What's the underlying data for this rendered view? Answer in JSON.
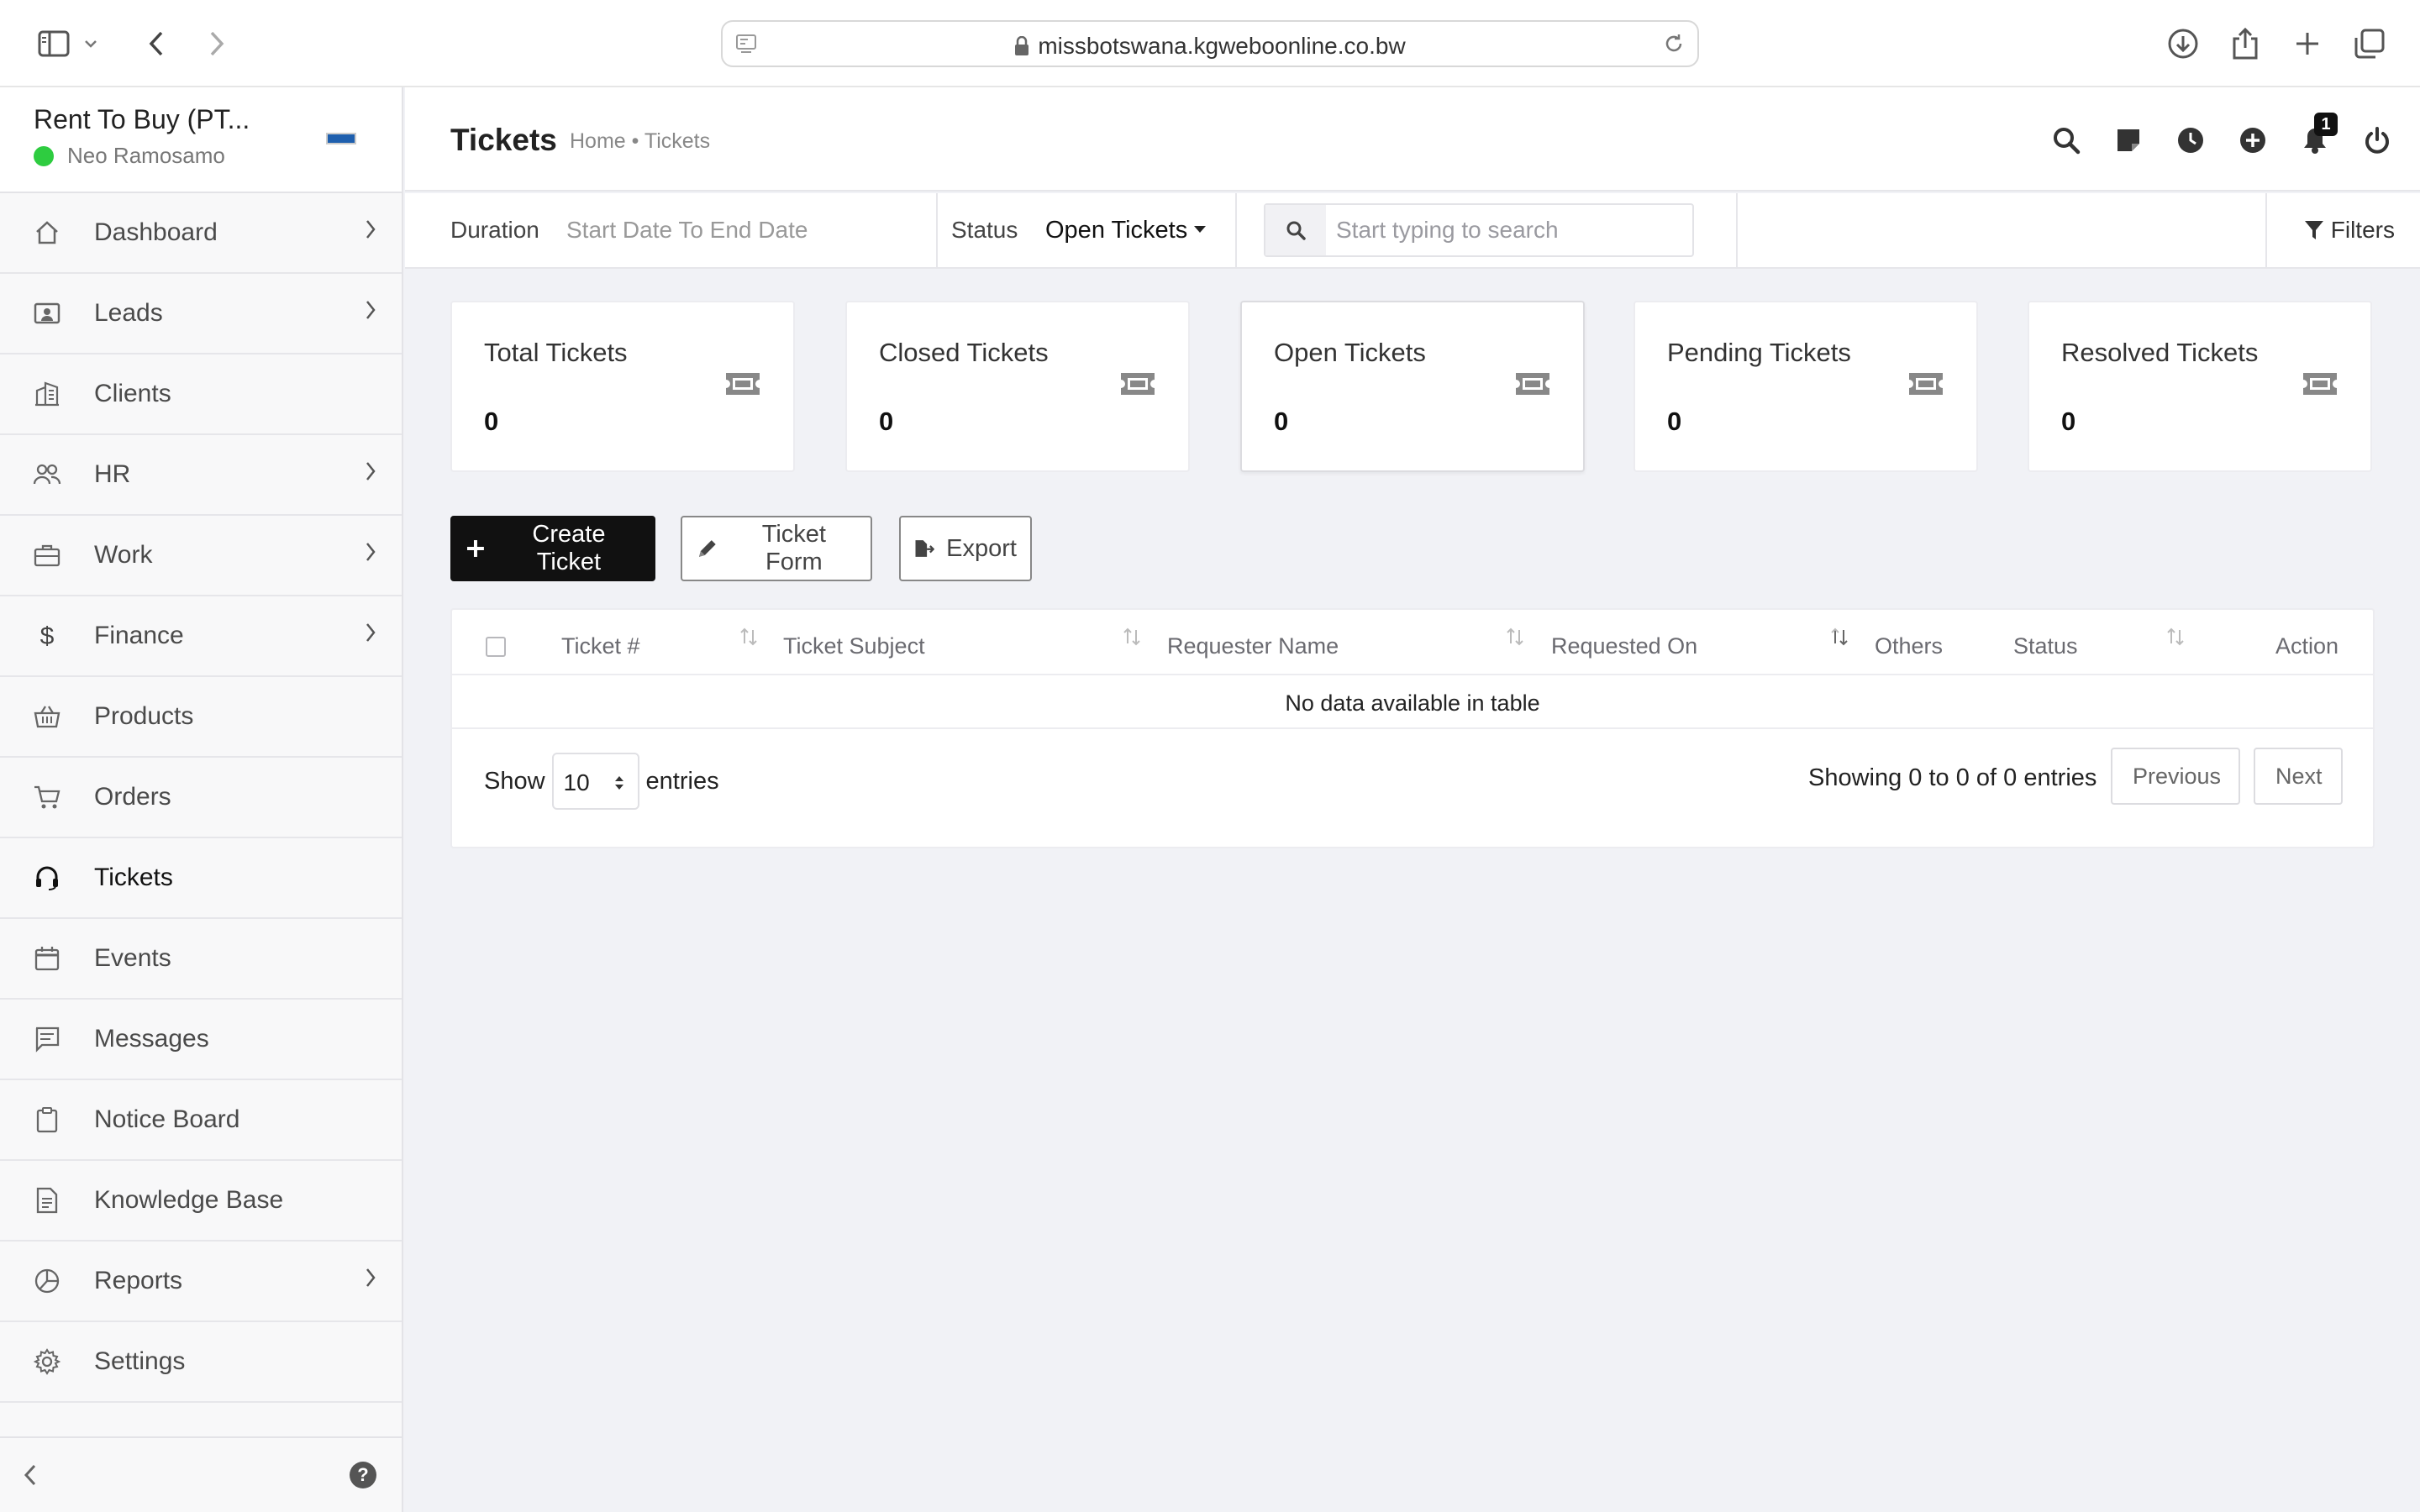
{
  "browser": {
    "url": "missbotswana.kgweboonline.co.bw"
  },
  "sidebar": {
    "company": "Rent To Buy (PT...",
    "user": "Neo Ramosamo",
    "items": [
      {
        "label": "Dashboard",
        "icon": "home-icon",
        "chevron": true
      },
      {
        "label": "Leads",
        "icon": "contact-card-icon",
        "chevron": true
      },
      {
        "label": "Clients",
        "icon": "building-icon",
        "chevron": false
      },
      {
        "label": "HR",
        "icon": "people-icon",
        "chevron": true
      },
      {
        "label": "Work",
        "icon": "briefcase-icon",
        "chevron": true
      },
      {
        "label": "Finance",
        "icon": "dollar-icon",
        "chevron": true
      },
      {
        "label": "Products",
        "icon": "basket-icon",
        "chevron": false
      },
      {
        "label": "Orders",
        "icon": "cart-icon",
        "chevron": false
      },
      {
        "label": "Tickets",
        "icon": "headset-icon",
        "chevron": false,
        "active": true
      },
      {
        "label": "Events",
        "icon": "calendar-icon",
        "chevron": false
      },
      {
        "label": "Messages",
        "icon": "chat-icon",
        "chevron": false
      },
      {
        "label": "Notice Board",
        "icon": "clipboard-icon",
        "chevron": false
      },
      {
        "label": "Knowledge Base",
        "icon": "document-icon",
        "chevron": false
      },
      {
        "label": "Reports",
        "icon": "pie-chart-icon",
        "chevron": true
      },
      {
        "label": "Settings",
        "icon": "gear-icon",
        "chevron": false
      }
    ],
    "help": "?"
  },
  "header": {
    "title": "Tickets",
    "breadcrumb": "Home • Tickets",
    "notification_count": "1"
  },
  "filters": {
    "duration_label": "Duration",
    "duration_value": "Start Date To End Date",
    "status_label": "Status",
    "status_value": "Open Tickets",
    "search_placeholder": "Start typing to search",
    "filters_label": "Filters"
  },
  "cards": [
    {
      "title": "Total Tickets",
      "value": "0"
    },
    {
      "title": "Closed Tickets",
      "value": "0"
    },
    {
      "title": "Open Tickets",
      "value": "0"
    },
    {
      "title": "Pending Tickets",
      "value": "0"
    },
    {
      "title": "Resolved Tickets",
      "value": "0"
    }
  ],
  "actions": {
    "create": "Create Ticket",
    "form": "Ticket Form",
    "export": "Export"
  },
  "table": {
    "columns": [
      "Ticket #",
      "Ticket Subject",
      "Requester Name",
      "Requested On",
      "Others",
      "Status",
      "Action"
    ],
    "empty": "No data available in table",
    "show_label": "Show",
    "page_size": "10",
    "entries_label": "entries",
    "info": "Showing 0 to 0 of 0 entries",
    "previous": "Previous",
    "next": "Next"
  },
  "colors": {
    "accent": "#111111",
    "online": "#2ecc40",
    "background": "#f1f2f6"
  }
}
